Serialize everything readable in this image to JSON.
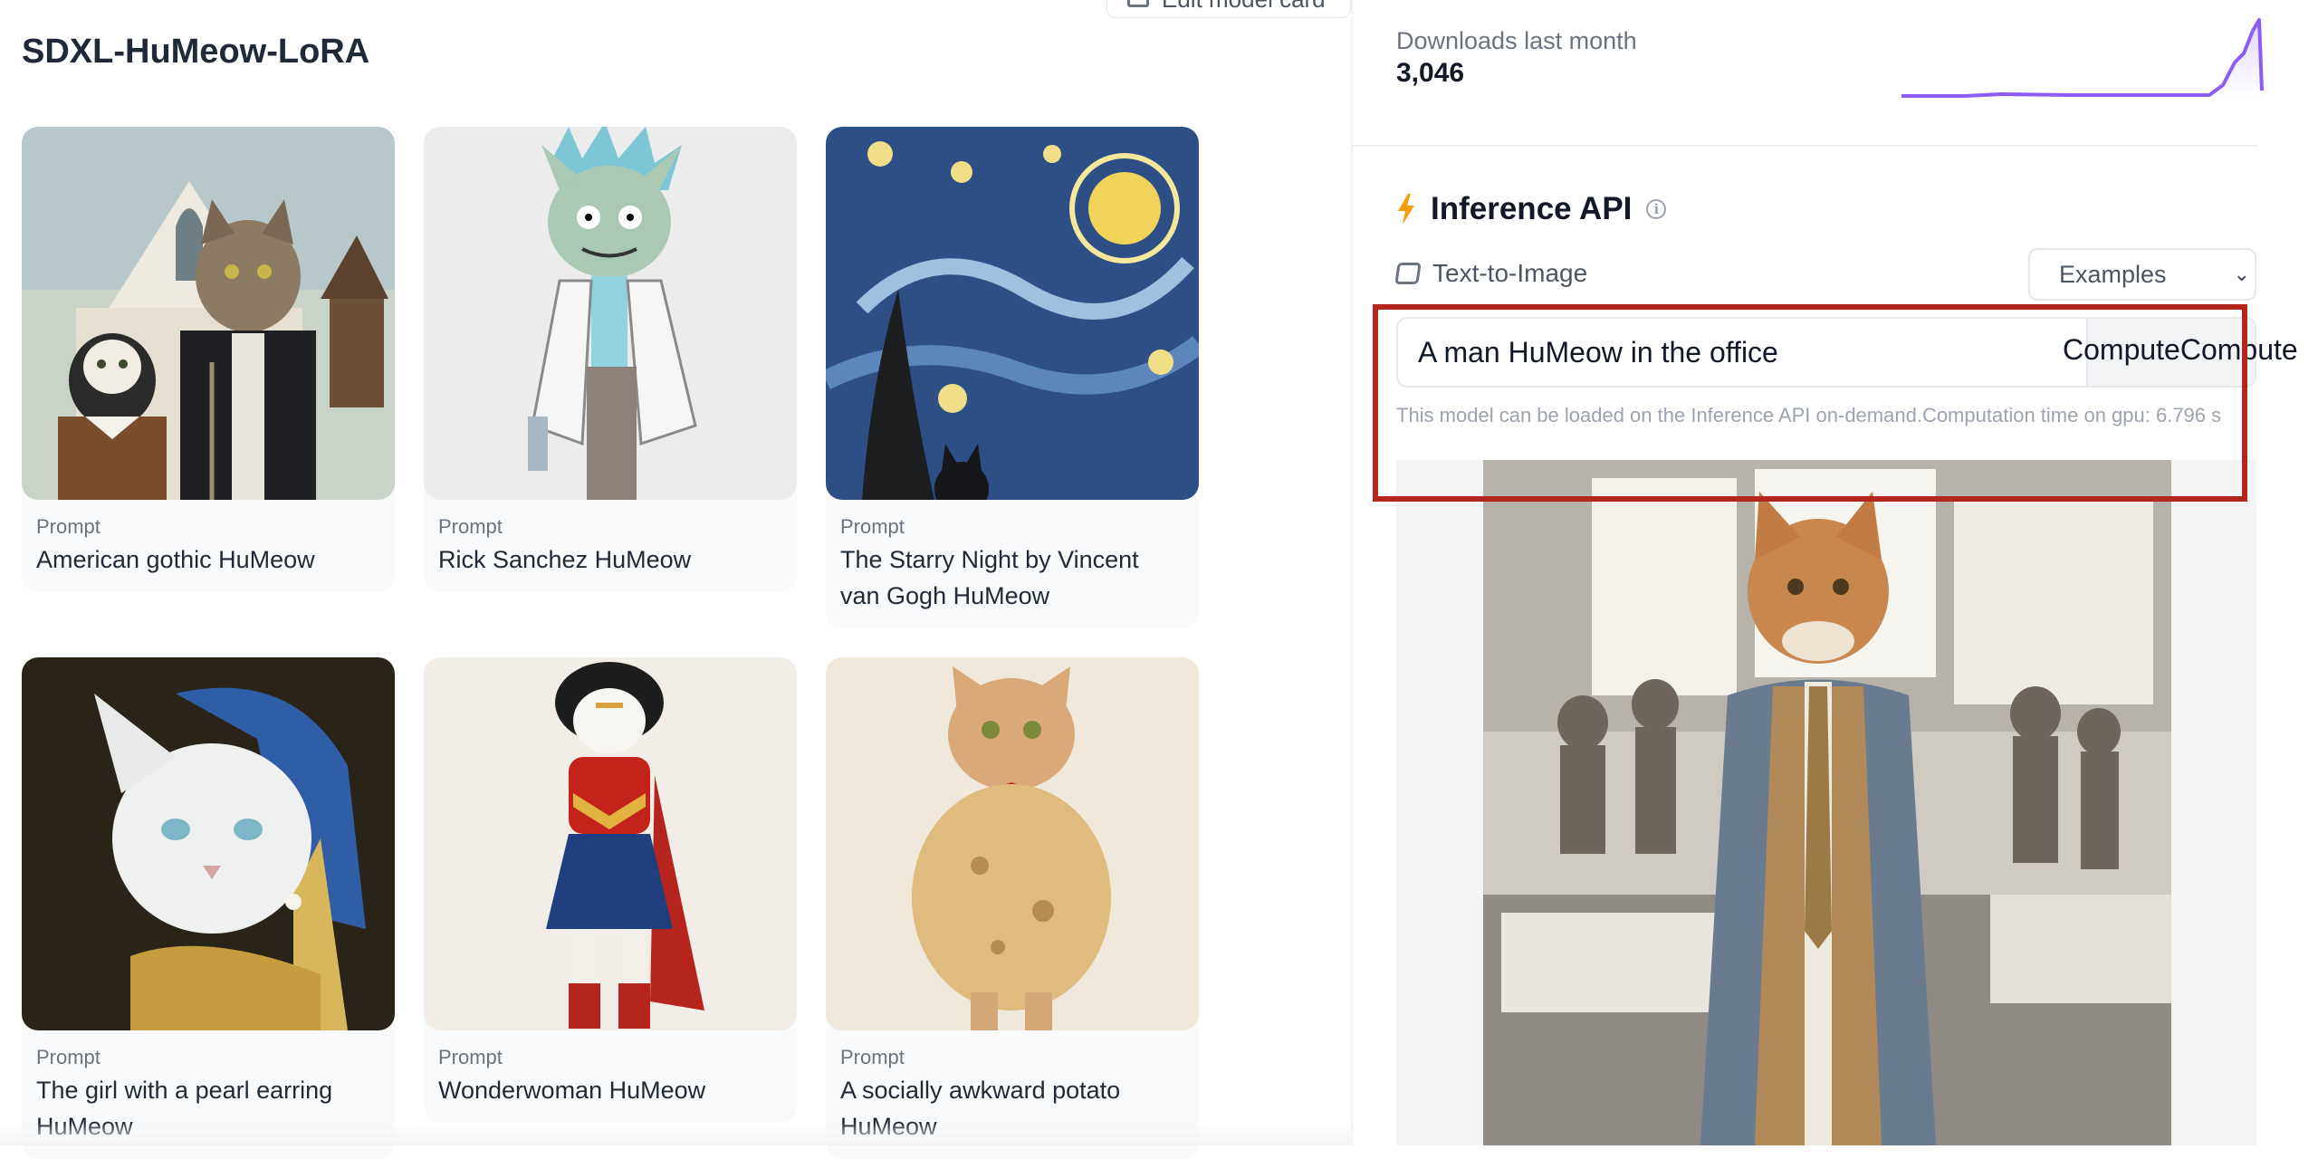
{
  "header": {
    "model_title": "SDXL-HuMeow-LoRA",
    "edit_card_label": "Edit model card"
  },
  "gallery": {
    "items": [
      {
        "label": "Prompt",
        "prompt": "American gothic HuMeow"
      },
      {
        "label": "Prompt",
        "prompt": "Rick Sanchez HuMeow"
      },
      {
        "label": "Prompt",
        "prompt": "The Starry Night by Vincent van Gogh HuMeow"
      },
      {
        "label": "Prompt",
        "prompt": "The girl with a pearl earring HuMeow"
      },
      {
        "label": "Prompt",
        "prompt": "Wonderwoman HuMeow"
      },
      {
        "label": "Prompt",
        "prompt": "A socially awkward potato HuMeow"
      }
    ]
  },
  "downloads": {
    "label": "Downloads last month",
    "value": "3,046",
    "sparkline_color": "#8b5cf6"
  },
  "inference": {
    "title": "Inference API",
    "info_icon": "info-icon",
    "task_label": "Text-to-Image",
    "examples_label": "Examples",
    "prompt_value": "A man HuMeow in the office",
    "compute_label": "ComputeCompute",
    "notice": "This model can be loaded on the Inference API on-demand.Computation time on gpu: 6.796 s",
    "highlight_color": "#b3261e"
  }
}
